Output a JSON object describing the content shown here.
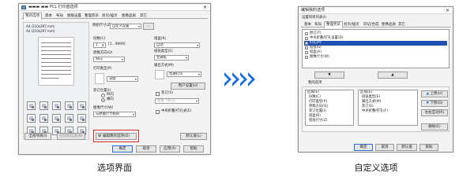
{
  "left_window": {
    "title": "▬▬▬ ▬▬ PCL 打印首选项",
    "tabs": [
      "我的选项",
      "基本",
      "布局",
      "图纸设置",
      "整理完毕",
      "封页/插页",
      "图像品质",
      "其它"
    ],
    "preview_line1": "A4 (210x297 mm)",
    "preview_line2": "A4 (210x297 mm)",
    "paper_size_label": "原始尺寸(Z)",
    "paper_size_value": "自定义设置",
    "copies_label": "份数(C)",
    "copies_value": "1",
    "copies_range": "[1...9999]",
    "orientation_label": "原稿方向(Q)",
    "orientation_value": "纵向",
    "print_type_label": "打印类型(P)",
    "print_type_value": "双面",
    "binding_label": "装订位置(I)",
    "binding_value": "左侧装订",
    "output_label": "图像尺寸(W)",
    "output_value": "与原稿尺寸相同",
    "staple_label": "装订方向(Y)",
    "staple_opt1": "纵向",
    "staple_opt2": "横向",
    "paper_tray_label": "纸盒(R)",
    "paper_tray_value": "自动",
    "paper_type_label": "纸张类型(E)",
    "paper_type_value": "普通纸",
    "output_method_label": "输出方式(M)",
    "output_method_value": "普通打印",
    "user_setting_button": "用户设置(U)",
    "staple_check_label": "装订(S)",
    "staple_pos_value": "左角（装订）",
    "punch_check_label": "中央折叠/打孔式(E)",
    "settings_list_button": "全部项目(I)",
    "printer_info_button": "打印机信息(N)",
    "custom_options_button": "编辑我的选项(D)",
    "default_button": "默认值(L)",
    "ok_button": "确定",
    "cancel_button": "取消",
    "apply_button": "应用(A)",
    "help_button": "帮助"
  },
  "right_window": {
    "title": "编辑我的选项",
    "settings_label": "设置项目列表(I)",
    "tabs": [
      "基本",
      "布局",
      "整理完毕",
      "封页/插页",
      "印记/合成",
      "图像品质",
      "其它"
    ],
    "list_items": [
      "原订(T)",
      "中央折叠/打孔设置(D)",
      "打孔(P)",
      "纸张(S)",
      "纸盒(A)",
      "图像尺寸(W)"
    ],
    "add_button": "▼",
    "remove_button": "▲",
    "my_options_label": "我的选项",
    "col1_header": "区域(E)",
    "col2_header": "区域(E)",
    "col1_items": [
      "份数(C)",
      "打印类型(P)",
      "原稿方向(Q)",
      "装订位置(I)",
      "纸盒(R)",
      "纸张尺寸(Z)"
    ],
    "col2_items": [
      "纸张类型(E)",
      "输出方式(M)",
      "装订(S)",
      "中央折叠/打孔(F)"
    ],
    "up_button": "上移(U)",
    "down_button": "下移(D)",
    "move_left_button": "左右互动(R)",
    "delete_button": "删除(E)",
    "ok_button": "确定",
    "cancel_button": "取消",
    "default_button": "默认值",
    "help_button": "帮助"
  },
  "captions": {
    "left": "选项界面",
    "right": "自定义选项"
  },
  "colors": {
    "arrow": "#1f6fd0",
    "highlight": "#d72b2b",
    "selection": "#1f4fb0"
  }
}
